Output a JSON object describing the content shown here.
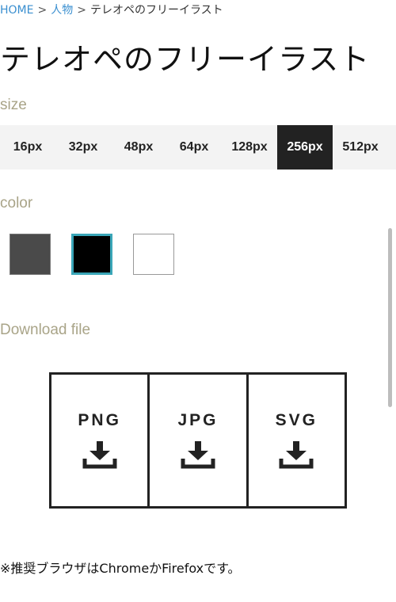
{
  "breadcrumb": {
    "home": "HOME",
    "category": "人物",
    "current": "テレオペのフリーイラスト",
    "separator": ">"
  },
  "page_title": "テレオペのフリーイラスト",
  "size": {
    "label": "size",
    "options": [
      "16px",
      "32px",
      "48px",
      "64px",
      "128px",
      "256px",
      "512px"
    ],
    "selected": "256px"
  },
  "color": {
    "label": "color",
    "swatches": [
      "#4a4a4a",
      "#000000",
      "#ffffff"
    ],
    "selected": "#000000",
    "selected_border": "#3aa6b8"
  },
  "download": {
    "label": "Download file",
    "formats": [
      "PNG",
      "JPG",
      "SVG"
    ],
    "icon": "download-icon"
  },
  "footnote": "※推奨ブラウザはChromeかFirefoxです。"
}
